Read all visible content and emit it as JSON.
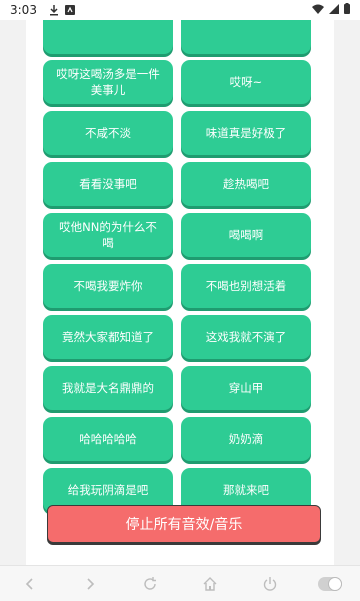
{
  "status_bar": {
    "time": "3:03"
  },
  "buttons": [
    {
      "label": ""
    },
    {
      "label": ""
    },
    {
      "label": "哎呀这喝汤多是一件美事儿"
    },
    {
      "label": "哎呀~"
    },
    {
      "label": "不咸不淡"
    },
    {
      "label": "味道真是好极了"
    },
    {
      "label": "看看没事吧"
    },
    {
      "label": "趁热喝吧"
    },
    {
      "label": "哎他NN的为什么不喝"
    },
    {
      "label": "喝喝啊"
    },
    {
      "label": "不喝我要炸你"
    },
    {
      "label": "不喝也别想活着"
    },
    {
      "label": "竟然大家都知道了"
    },
    {
      "label": "这戏我就不演了"
    },
    {
      "label": "我就是大名鼎鼎的"
    },
    {
      "label": "穿山甲"
    },
    {
      "label": "哈哈哈哈哈"
    },
    {
      "label": "奶奶滴"
    },
    {
      "label": "给我玩阴滴是吧"
    },
    {
      "label": "那就来吧"
    }
  ],
  "stop_button": {
    "label": "停止所有音效/音乐"
  },
  "colors": {
    "accent": "#2ecc94",
    "stop": "#f56c6c"
  }
}
